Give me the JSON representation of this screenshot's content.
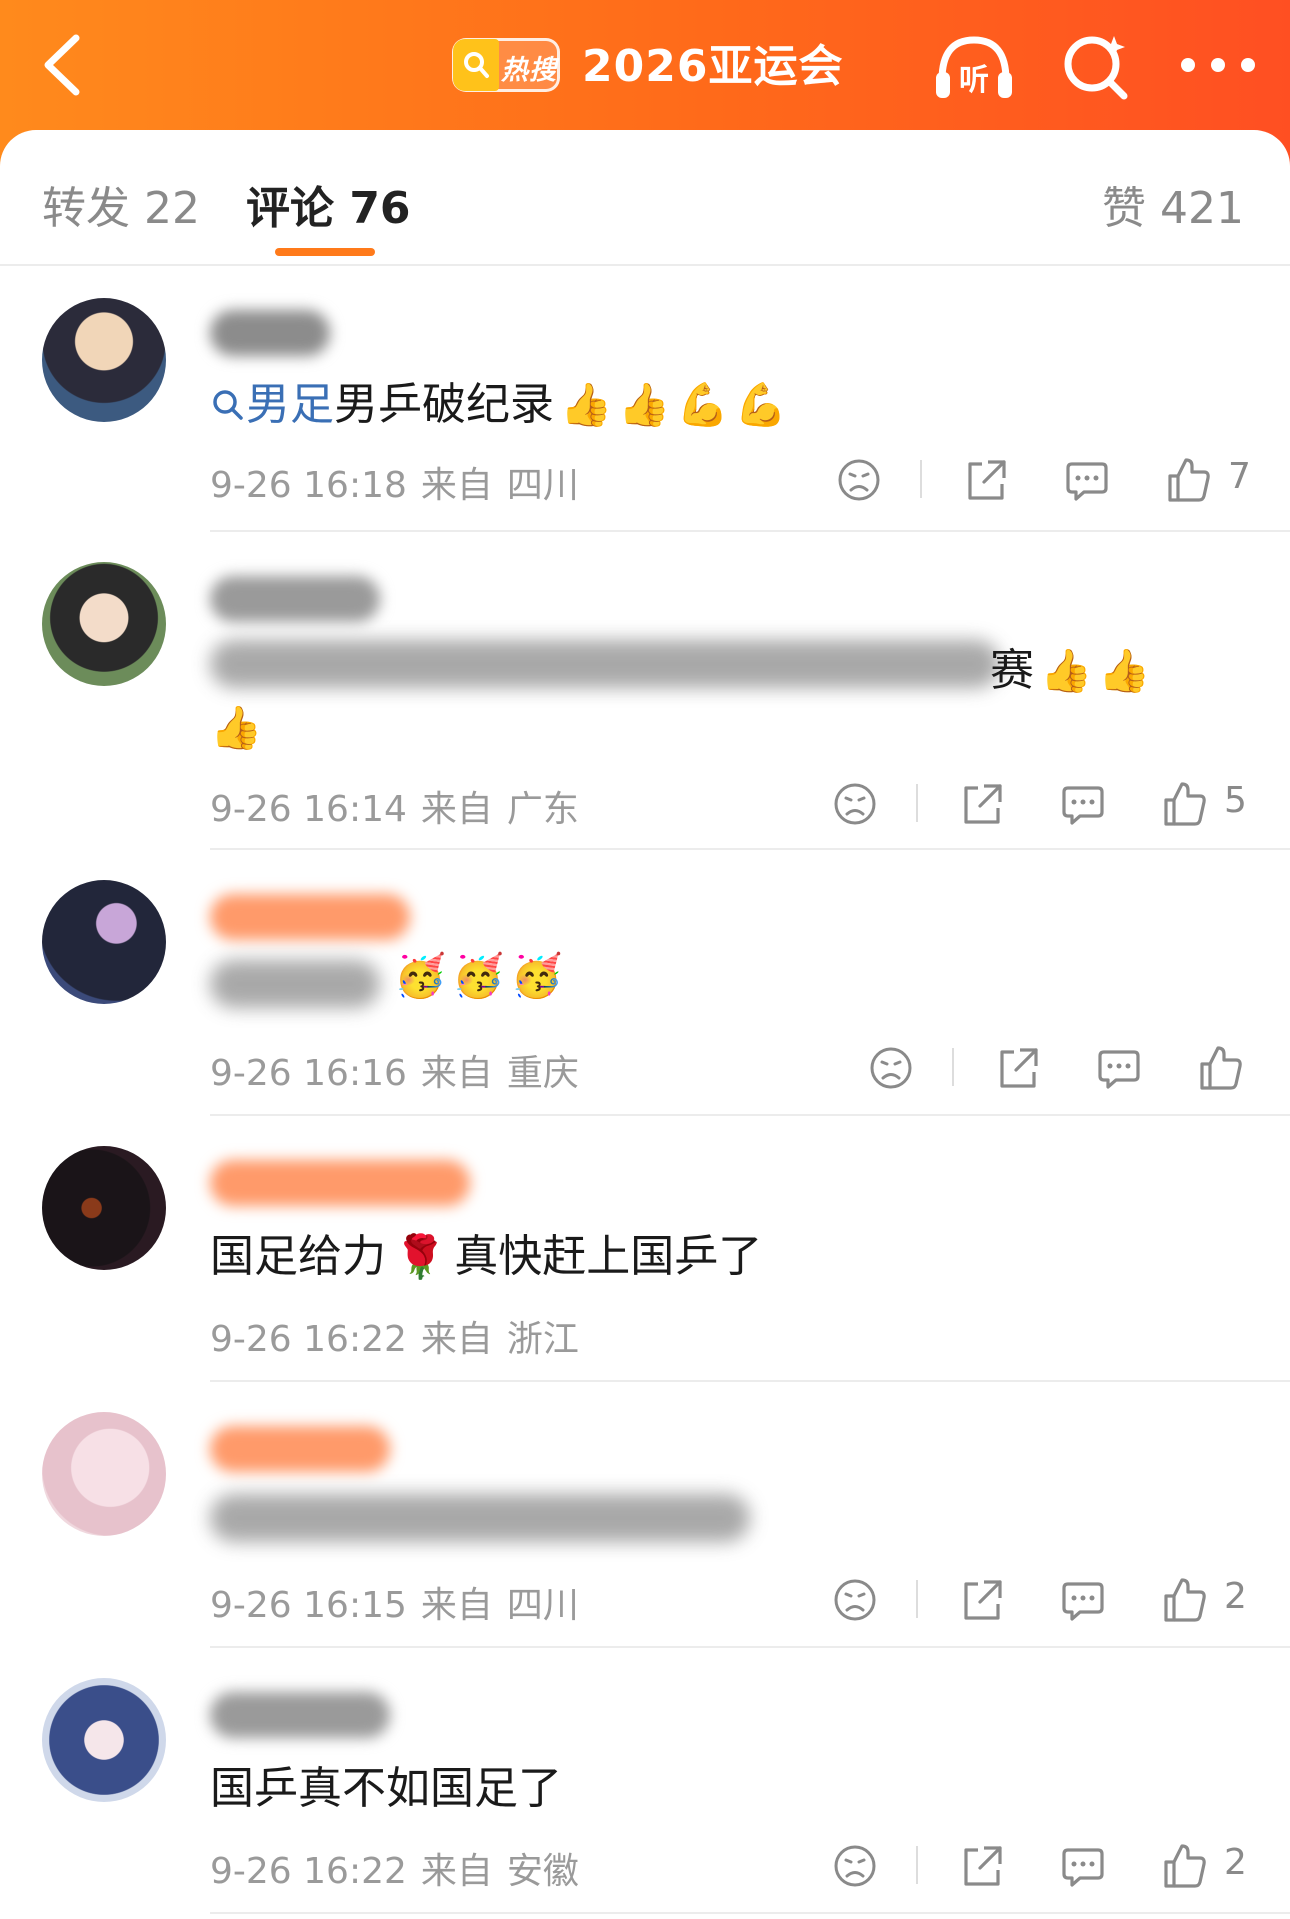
{
  "header": {
    "hot_label": "热搜",
    "title": "2026亚运会",
    "listen_label": "听",
    "back_icon": "chevron-left-icon",
    "search_icon": "search-sparkle-icon",
    "more_icon": "more-dots-icon",
    "accent": "#ff6a1a"
  },
  "tabs": {
    "repost": "转发 22",
    "comments": "评论 76",
    "likes": "赞 421"
  },
  "comments": [
    {
      "topic": "男足",
      "text": "男乒破纪录",
      "emojis": [
        "👍",
        "👍",
        "💪",
        "💪"
      ],
      "time": "9-26 16:18",
      "from_label": "来自",
      "location": "四川",
      "likes": "7"
    },
    {
      "text_visible": "赛",
      "emojis": [
        "👍",
        "👍",
        "👍"
      ],
      "time": "9-26 16:14",
      "from_label": "来自",
      "location": "广东",
      "likes": "5"
    },
    {
      "emojis": [
        "🥳",
        "🥳",
        "🥳"
      ],
      "time": "9-26 16:16",
      "from_label": "来自",
      "location": "重庆",
      "likes": ""
    },
    {
      "text": "国足给力",
      "emoji": "🌹",
      "text2": "真快赶上国乒了",
      "time": "9-26 16:22",
      "from_label": "来自",
      "location": "浙江"
    },
    {
      "time": "9-26 16:15",
      "from_label": "来自",
      "location": "四川",
      "likes": "2"
    },
    {
      "text": "国乒真不如国足了",
      "time": "9-26 16:22",
      "from_label": "来自",
      "location": "安徽",
      "likes": "2"
    }
  ]
}
